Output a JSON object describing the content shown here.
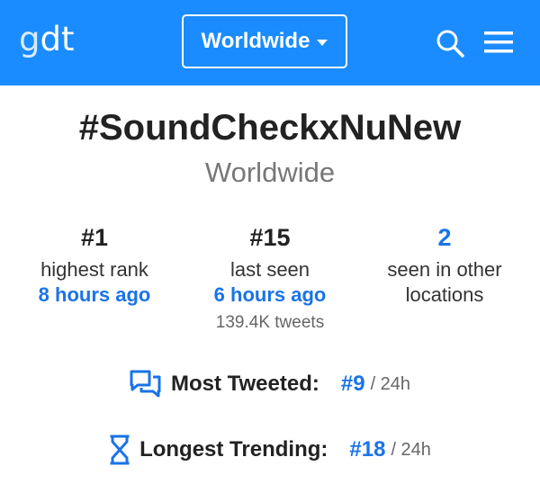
{
  "header": {
    "logo_g": "g",
    "logo_dt": "dt",
    "location_button": "Worldwide",
    "icons": [
      "search-icon",
      "menu-icon"
    ],
    "brand_color": "#1a8cff"
  },
  "trend": {
    "title": "#SoundCheckxNuNew",
    "location": "Worldwide"
  },
  "stats": {
    "highest": {
      "value": "#1",
      "label": "highest rank",
      "time": "8 hours ago"
    },
    "last": {
      "value": "#15",
      "label": "last seen",
      "time": "6 hours ago",
      "tweets": "139.4K tweets"
    },
    "other": {
      "value": "2",
      "label_line1": "seen in other",
      "label_line2": "locations"
    }
  },
  "most_tweeted": {
    "label": "Most Tweeted:",
    "value": "#9",
    "suffix": "/ 24h",
    "icon": "chat-icon"
  },
  "longest_trending": {
    "label": "Longest Trending:",
    "value": "#18",
    "suffix": "/ 24h",
    "icon": "hourglass-icon"
  },
  "accent_color": "#1a73e8"
}
